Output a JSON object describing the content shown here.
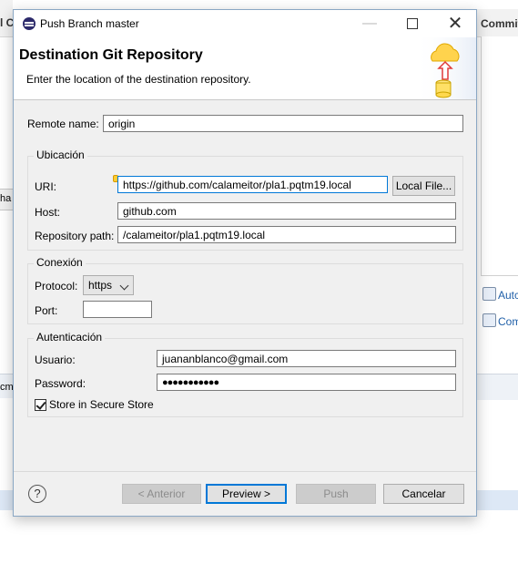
{
  "background": {
    "left_top_label": "l C",
    "left_mid_label": "ha",
    "left_low_label": "cm",
    "right_top_label": "Commit",
    "right_links": [
      "Autc",
      "Com"
    ]
  },
  "window": {
    "title": "Push Branch master"
  },
  "header": {
    "title": "Destination Git Repository",
    "description": "Enter the location of the destination repository."
  },
  "form": {
    "remote_name_label": "Remote name:",
    "remote_name_value": "origin",
    "location": {
      "title": "Ubicación",
      "uri_label": "URI:",
      "uri_value": "https://github.com/calameitor/pla1.pqtm19.local",
      "local_file_button": "Local File...",
      "host_label": "Host:",
      "host_value": "github.com",
      "repo_path_label": "Repository path:",
      "repo_path_value": "/calameitor/pla1.pqtm19.local"
    },
    "connection": {
      "title": "Conexión",
      "protocol_label": "Protocol:",
      "protocol_value": "https",
      "port_label": "Port:",
      "port_value": ""
    },
    "authentication": {
      "title": "Autenticación",
      "user_label": "Usuario:",
      "user_value": "juananblanco@gmail.com",
      "password_label": "Password:",
      "password_value": "●●●●●●●●●●●",
      "store_label": "Store in Secure Store",
      "store_checked": true
    }
  },
  "footer": {
    "help_symbol": "?",
    "back_label": "< Anterior",
    "preview_label": "Preview >",
    "push_label": "Push",
    "cancel_label": "Cancelar"
  }
}
